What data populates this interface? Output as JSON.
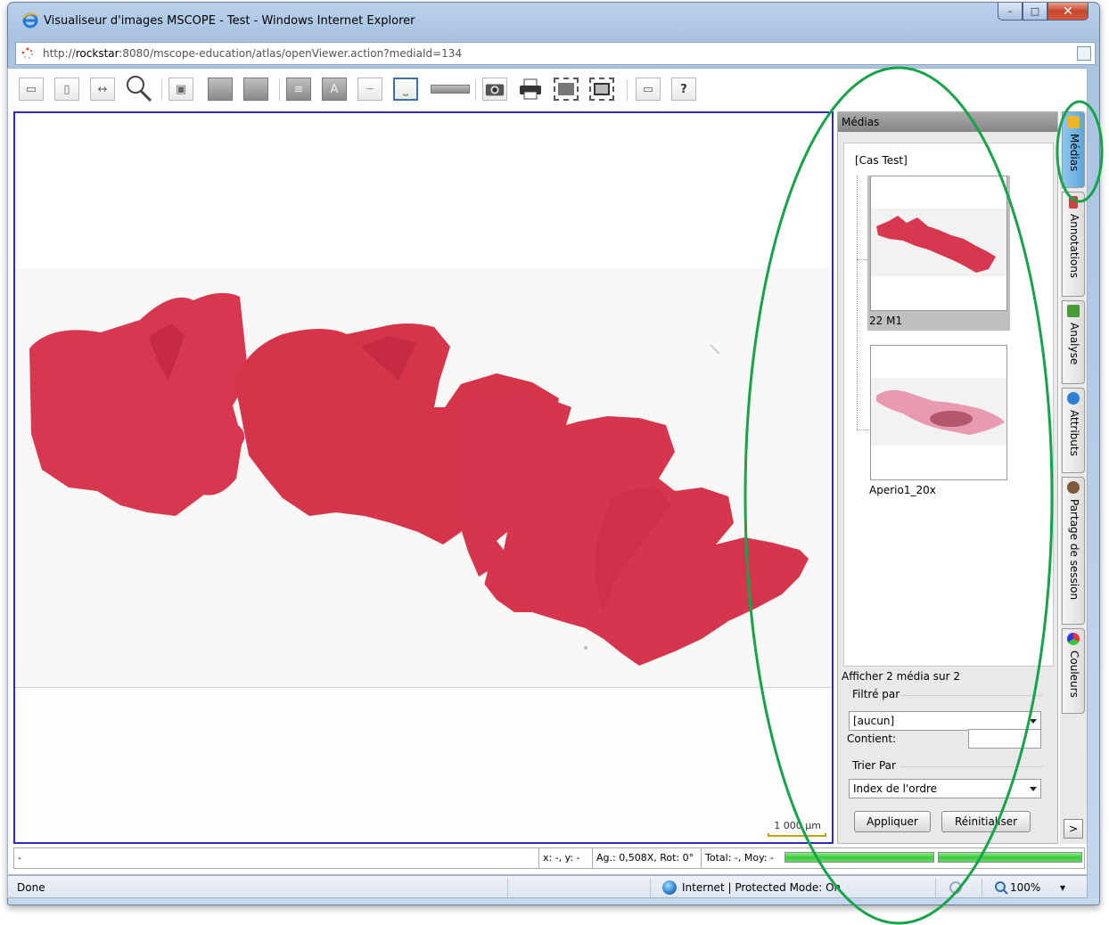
{
  "window": {
    "title": "Visualiseur d'images MSCOPE - Test - Windows Internet Explorer",
    "minimize_label": "–",
    "maximize_label": "□",
    "close_label": "✕"
  },
  "address": {
    "url_prefix": "http://",
    "url_host": "rockstar",
    "url_rest": ":8080/mscope-education/atlas/openViewer.action?mediaId=134"
  },
  "toolbar": {
    "help_label": "?",
    "text_tool_label": "A"
  },
  "viewer": {
    "scale_label": "1 000 µm"
  },
  "panel": {
    "header": "Médias",
    "case_label": "[Cas Test]",
    "media": [
      {
        "name": "22 M1",
        "selected": true
      },
      {
        "name": "Aperio1_20x",
        "selected": false
      }
    ],
    "count_text": "Afficher 2 média sur 2",
    "filter_label": "Filtré par",
    "filter_value": "[aucun]",
    "contains_label": "Contient:",
    "sort_label": "Trier Par",
    "sort_value": "Index de l'ordre",
    "apply_label": "Appliquer",
    "reset_label": "Réinitialiser"
  },
  "vtabs": [
    {
      "label": "Médias",
      "icon": "folder-icon",
      "color": "#f0b429"
    },
    {
      "label": "Annotations",
      "icon": "pencil-icon",
      "color": "#d04040"
    },
    {
      "label": "Analyse",
      "icon": "chart-icon",
      "color": "#4a9a3a"
    },
    {
      "label": "Attributs",
      "icon": "info-icon",
      "color": "#2f7fd0"
    },
    {
      "label": "Partage de session",
      "icon": "users-icon",
      "color": "#7a5a3a"
    },
    {
      "label": "Couleurs",
      "icon": "palette-icon",
      "color": "#c03070"
    }
  ],
  "expand_label": ">",
  "viewer_status": {
    "left_text": "-",
    "coords": "x: -, y: -",
    "zoom_rot": "Ag.: 0,508X, Rot: 0°",
    "total": "Total: -, Moy: -"
  },
  "ie_status": {
    "done": "Done",
    "zone": "Internet | Protected Mode: On",
    "zoom": "100%",
    "zoom_arrow": "▾"
  },
  "colors": {
    "tissue": "#d8384f",
    "annotation": "#16a34a",
    "viewer_border": "#2b2bbf"
  }
}
